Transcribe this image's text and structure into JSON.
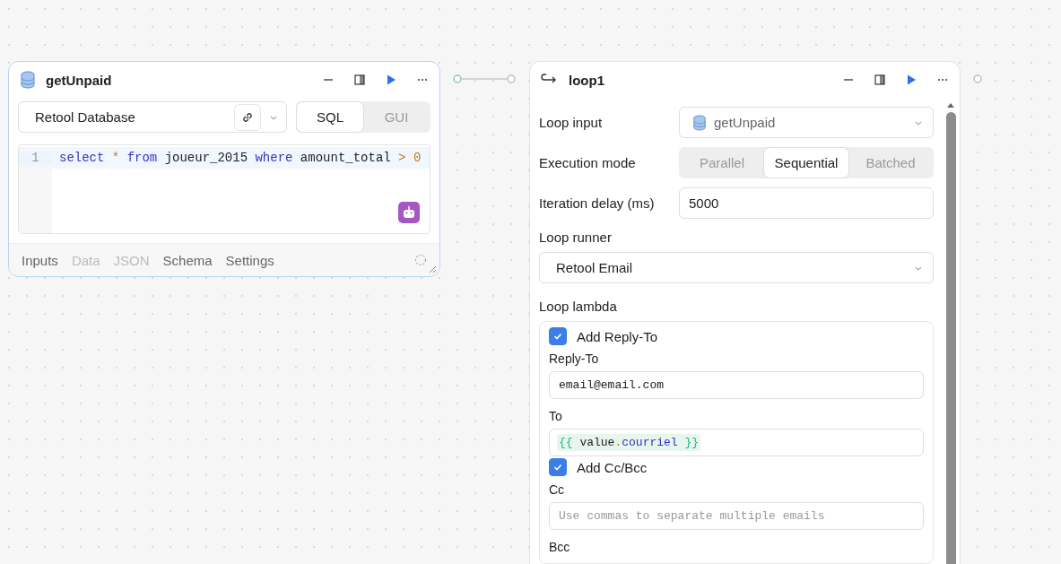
{
  "query_node": {
    "title": "getUnpaid",
    "resource": "Retool Database",
    "modes": [
      {
        "label": "SQL",
        "selected": true
      },
      {
        "label": "GUI",
        "selected": false
      }
    ],
    "code_lines": [
      {
        "number": "1",
        "tokens": [
          {
            "text": "select ",
            "kind": "keyword"
          },
          {
            "text": "* ",
            "kind": "operator"
          },
          {
            "text": "from",
            "kind": "keyword"
          },
          {
            "text": " joueur_2015 ",
            "kind": "plain"
          },
          {
            "text": "where",
            "kind": "keyword"
          },
          {
            "text": " amount_total ",
            "kind": "plain"
          },
          {
            "text": "> ",
            "kind": "operator"
          },
          {
            "text": "0",
            "kind": "number"
          }
        ]
      }
    ],
    "tabs": [
      {
        "label": "Inputs",
        "disabled": false
      },
      {
        "label": "Data",
        "disabled": true
      },
      {
        "label": "JSON",
        "disabled": true
      },
      {
        "label": "Schema",
        "disabled": false
      },
      {
        "label": "Settings",
        "disabled": false
      }
    ]
  },
  "loop_node": {
    "title": "loop1",
    "loop_input": {
      "label": "Loop input",
      "value": "getUnpaid"
    },
    "execution_mode": {
      "label": "Execution mode",
      "options": [
        {
          "label": "Parallel",
          "selected": false
        },
        {
          "label": "Sequential",
          "selected": true
        },
        {
          "label": "Batched",
          "selected": false
        }
      ]
    },
    "iteration_delay": {
      "label": "Iteration delay (ms)",
      "value": "5000"
    },
    "loop_runner": {
      "label": "Loop runner",
      "value": "Retool Email"
    },
    "loop_lambda": {
      "label": "Loop lambda",
      "items": [
        {
          "kind": "checkbox",
          "label": "Add Reply-To",
          "checked": true
        },
        {
          "kind": "input",
          "label": "Reply-To",
          "value": "email@email.com"
        },
        {
          "kind": "template",
          "label": "To",
          "tokens": [
            {
              "text": "{{ ",
              "kind": "brace"
            },
            {
              "text": "value",
              "kind": "plain"
            },
            {
              "text": ".",
              "kind": "dot"
            },
            {
              "text": "courriel",
              "kind": "prop"
            },
            {
              "text": " }}",
              "kind": "brace"
            }
          ]
        },
        {
          "kind": "checkbox",
          "label": "Add Cc/Bcc",
          "checked": true
        },
        {
          "kind": "input",
          "label": "Cc",
          "placeholder": "Use commas to separate multiple emails"
        },
        {
          "kind": "label",
          "label": "Bcc"
        }
      ]
    }
  }
}
